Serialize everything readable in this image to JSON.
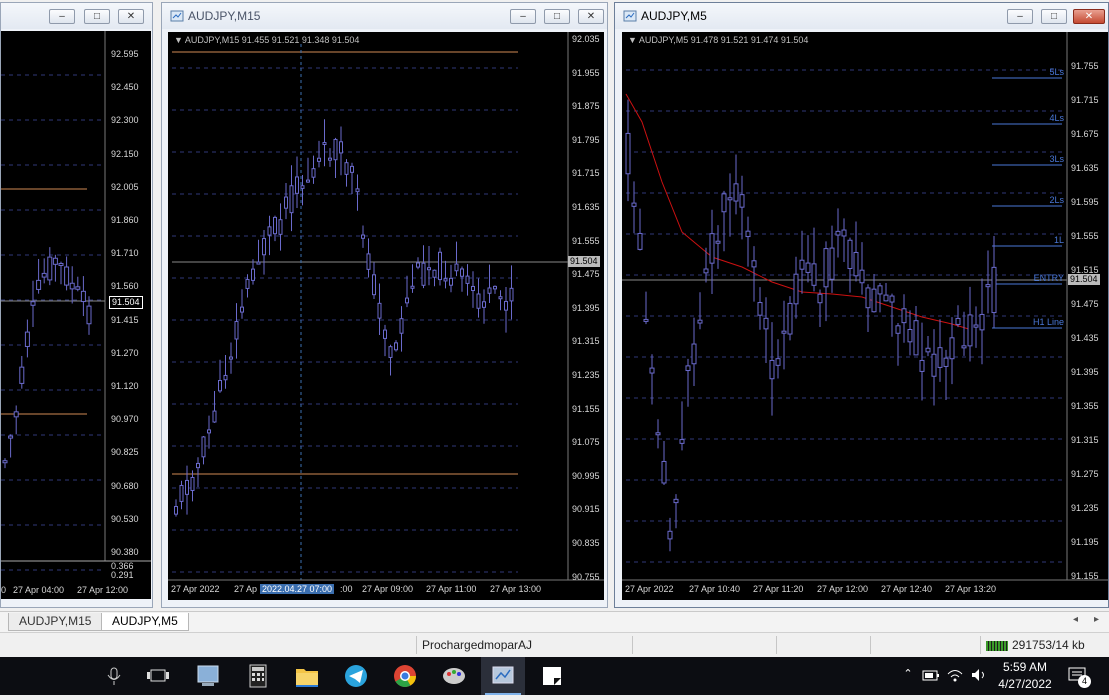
{
  "windows": {
    "left": {
      "price_labels": [
        "92.595",
        "92.450",
        "92.300",
        "92.150",
        "92.005",
        "91.860",
        "91.710",
        "91.560",
        "91.415",
        "91.270",
        "91.120",
        "90.970",
        "90.825",
        "90.680",
        "90.530",
        "90.380"
      ],
      "current_price": "91.504",
      "indicator_labels": [
        "0.366",
        "0.291"
      ],
      "time_labels": [
        "0",
        "27 Apr 04:00",
        "27 Apr 12:00"
      ]
    },
    "m15": {
      "title": "AUDJPY,M15",
      "ohlc": "AUDJPY,M15  91.455 91.521 91.348 91.504",
      "price_labels": [
        "92.035",
        "91.955",
        "91.875",
        "91.795",
        "91.715",
        "91.635",
        "91.555",
        "91.475",
        "91.395",
        "91.315",
        "91.235",
        "91.155",
        "91.075",
        "90.995",
        "90.915",
        "90.835",
        "90.755"
      ],
      "current_price": "91.504",
      "time_labels": [
        "27 Apr 2022",
        "27 Ap",
        "2022.04.27 07:00",
        ":00",
        "27 Apr 09:00",
        "27 Apr 11:00",
        "27 Apr 13:00"
      ]
    },
    "m5": {
      "title": "AUDJPY,M5",
      "ohlc": "AUDJPY,M5  91.478 91.521 91.474 91.504",
      "price_labels": [
        "91.755",
        "91.715",
        "91.675",
        "91.635",
        "91.595",
        "91.555",
        "91.515",
        "91.475",
        "91.435",
        "91.395",
        "91.355",
        "91.315",
        "91.275",
        "91.235",
        "91.195",
        "91.155"
      ],
      "current_price": "91.504",
      "level_labels": [
        "5Ls",
        "4Ls",
        "3Ls",
        "2Ls",
        "1L",
        "ENTRY",
        "H1 Line"
      ],
      "time_labels": [
        "27 Apr 2022",
        "27 Apr 10:40",
        "27 Apr 11:20",
        "27 Apr 12:00",
        "27 Apr 12:40",
        "27 Apr 13:20"
      ]
    }
  },
  "tabs": [
    "AUDJPY,M15",
    "AUDJPY,M5"
  ],
  "status": {
    "profile": "ProchargedmoparAJ",
    "traffic": "291753/14 kb"
  },
  "taskbar": {
    "apps": [
      "microphone-icon",
      "task-view-icon",
      "mt4-icon",
      "calculator-icon",
      "file-explorer-icon",
      "telegram-icon",
      "chrome-icon",
      "paint-icon",
      "metatrader-icon",
      "notes-icon"
    ],
    "time": "5:59 AM",
    "date": "4/27/2022",
    "notifications": "4"
  },
  "colors": {
    "candle": "#6a6acb",
    "level": "#d08a55",
    "ma": "#cc1111",
    "grid": "#2f3877"
  }
}
